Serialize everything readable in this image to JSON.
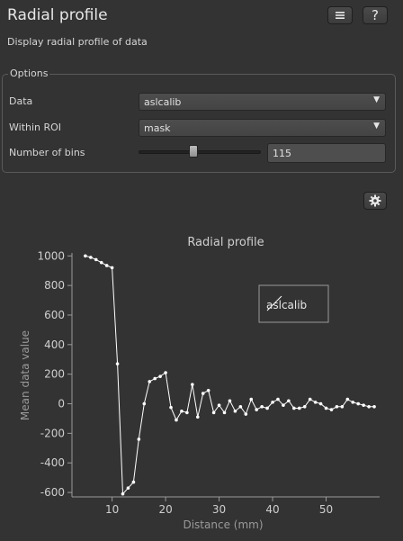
{
  "header": {
    "title": "Radial profile",
    "subtitle": "Display radial profile of data",
    "menu_icon": "menu-lines-icon",
    "help_label": "?"
  },
  "options": {
    "group_title": "Options",
    "data_label": "Data",
    "data_value": "aslcalib",
    "roi_label": "Within ROI",
    "roi_value": "mask",
    "bins_label": "Number of bins",
    "bins_value": "115",
    "bins_slider_fraction": 0.42
  },
  "plot_options_icon": "gear-icon",
  "colors": {
    "background": "#333333",
    "line": "#ffffff",
    "axis": "#9a9a9a"
  },
  "chart_data": {
    "type": "line",
    "title": "Radial profile",
    "xlabel": "Distance (mm)",
    "ylabel": "Mean data value",
    "xlim": [
      2.5,
      60
    ],
    "ylim": [
      -630,
      1020
    ],
    "xticks": [
      10,
      20,
      30,
      40,
      50
    ],
    "yticks": [
      1000,
      800,
      600,
      400,
      200,
      0,
      -200,
      -400,
      -600
    ],
    "legend": "top-right",
    "grid": false,
    "series": [
      {
        "name": "aslcalib",
        "x": [
          5,
          6,
          7,
          8,
          9,
          10,
          11,
          12,
          13,
          14,
          15,
          16,
          17,
          18,
          19,
          20,
          21,
          22,
          23,
          24,
          25,
          26,
          27,
          28,
          29,
          30,
          31,
          32,
          33,
          34,
          35,
          36,
          37,
          38,
          39,
          40,
          41,
          42,
          43,
          44,
          45,
          46,
          47,
          48,
          49,
          50,
          51,
          52,
          53,
          54,
          55,
          56,
          57,
          58,
          59
        ],
        "y": [
          1000,
          990,
          975,
          955,
          935,
          920,
          270,
          -610,
          -570,
          -530,
          -240,
          0,
          150,
          170,
          185,
          210,
          -25,
          -110,
          -50,
          -60,
          130,
          -90,
          70,
          90,
          -60,
          -10,
          -60,
          20,
          -50,
          -20,
          -70,
          30,
          -40,
          -20,
          -30,
          10,
          30,
          -10,
          20,
          -30,
          -30,
          -20,
          30,
          10,
          0,
          -30,
          -40,
          -20,
          -20,
          30,
          10,
          0,
          -10,
          -20,
          -20
        ]
      }
    ]
  }
}
